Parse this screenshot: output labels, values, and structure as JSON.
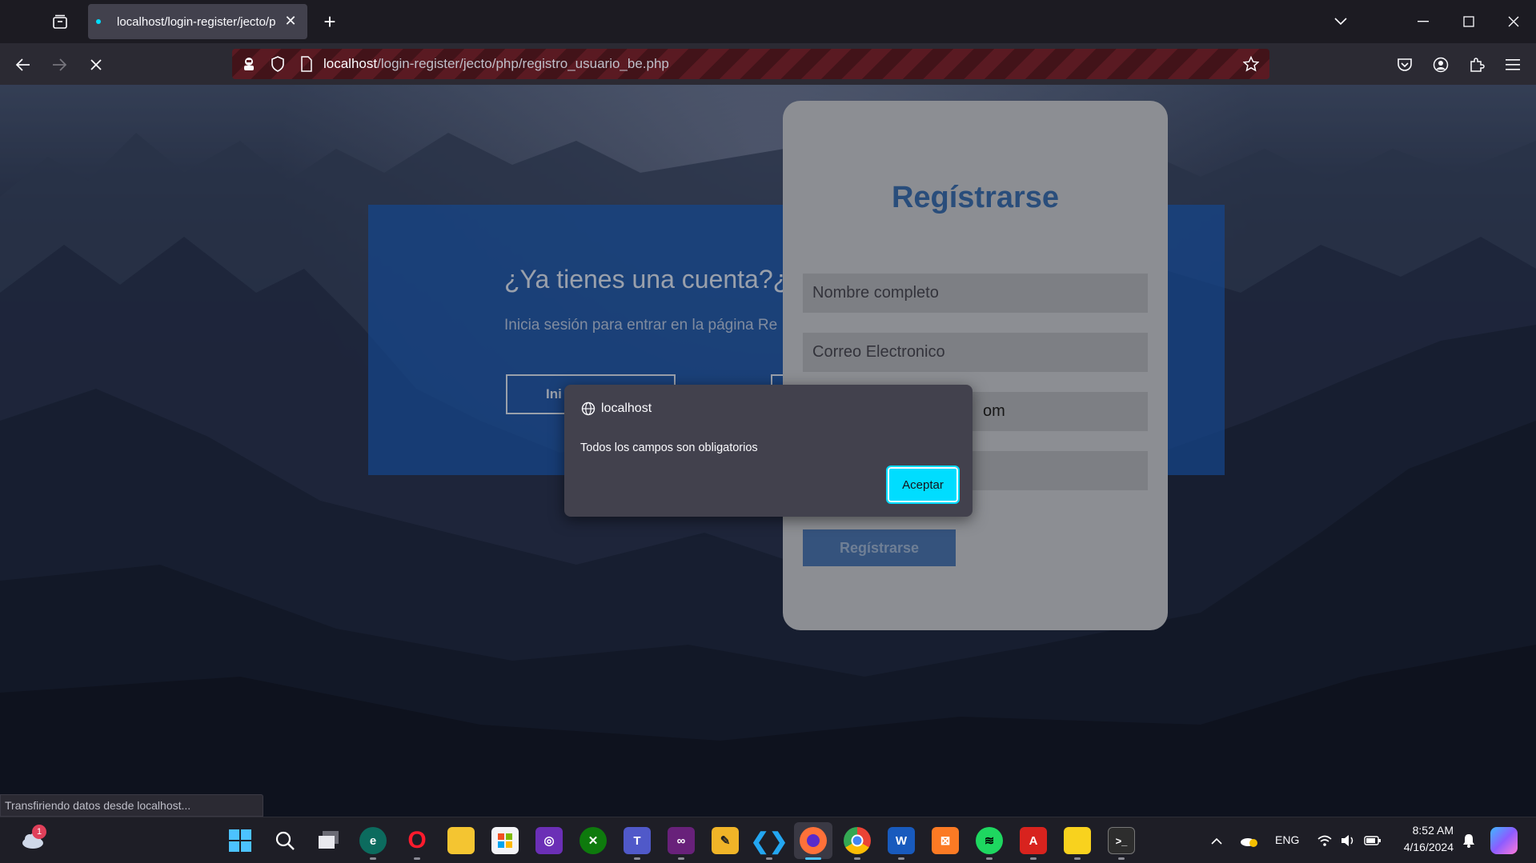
{
  "browser": {
    "tab_title": "localhost/login-register/jecto/p",
    "url_host": "localhost",
    "url_path": "/login-register/jecto/php/registro_usuario_be.php",
    "status_text": "Transfiriendo datos desde localhost..."
  },
  "page": {
    "panel_title": "¿Ya tienes una cuenta?¿",
    "panel_text": "Inicia sesión para entrar en la página  Re",
    "panel_login_btn": "Ini",
    "card_title": "Regístrarse",
    "fields": {
      "fullname_placeholder": "Nombre completo",
      "email_placeholder": "Correo Electronico",
      "third_value_partial": "om"
    },
    "register_btn": "Regístrarse"
  },
  "dialog": {
    "origin": "localhost",
    "message": "Todos los campos son obligatorios",
    "ok_label": "Aceptar"
  },
  "taskbar": {
    "weather_badge": "1",
    "language": "ENG",
    "time": "8:52 AM",
    "date": "4/16/2024"
  }
}
